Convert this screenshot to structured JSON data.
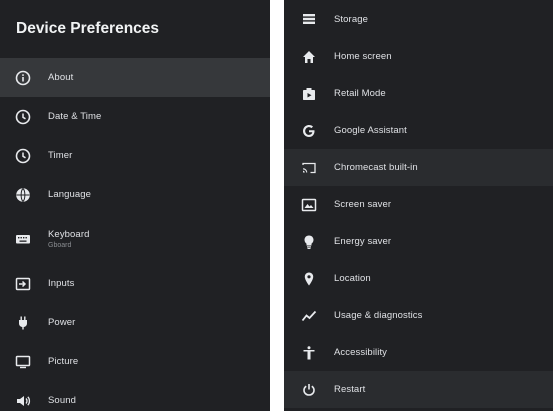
{
  "left_panel": {
    "title": "Device Preferences",
    "items": [
      {
        "label": "About",
        "icon": "info-icon",
        "selected": true
      },
      {
        "label": "Date & Time",
        "icon": "clock-icon"
      },
      {
        "label": "Timer",
        "icon": "timer-icon"
      },
      {
        "label": "Language",
        "icon": "globe-icon"
      },
      {
        "label": "Keyboard",
        "sublabel": "Gboard",
        "icon": "keyboard-icon"
      },
      {
        "label": "Inputs",
        "icon": "input-icon"
      },
      {
        "label": "Power",
        "icon": "power-plug-icon"
      },
      {
        "label": "Picture",
        "icon": "monitor-icon"
      },
      {
        "label": "Sound",
        "icon": "speaker-icon"
      }
    ]
  },
  "right_panel": {
    "items": [
      {
        "label": "Storage",
        "icon": "storage-icon"
      },
      {
        "label": "Home screen",
        "icon": "home-icon"
      },
      {
        "label": "Retail Mode",
        "icon": "retail-mode-icon"
      },
      {
        "label": "Google Assistant",
        "icon": "google-g-icon"
      },
      {
        "label": "Chromecast built-in",
        "icon": "cast-icon",
        "highlighted": true
      },
      {
        "label": "Screen saver",
        "icon": "screen-saver-icon"
      },
      {
        "label": "Energy saver",
        "icon": "lightbulb-icon"
      },
      {
        "label": "Location",
        "icon": "location-pin-icon"
      },
      {
        "label": "Usage & diagnostics",
        "icon": "diagnostics-icon"
      },
      {
        "label": "Accessibility",
        "icon": "accessibility-icon"
      },
      {
        "label": "Restart",
        "icon": "restart-icon",
        "highlighted": true
      }
    ]
  },
  "colors": {
    "panel_bg": "#202124",
    "selected_bg": "#36383b",
    "highlight_bg": "#2a2c2f",
    "text": "#dfe1e5",
    "page_bg": "#ffffff"
  }
}
